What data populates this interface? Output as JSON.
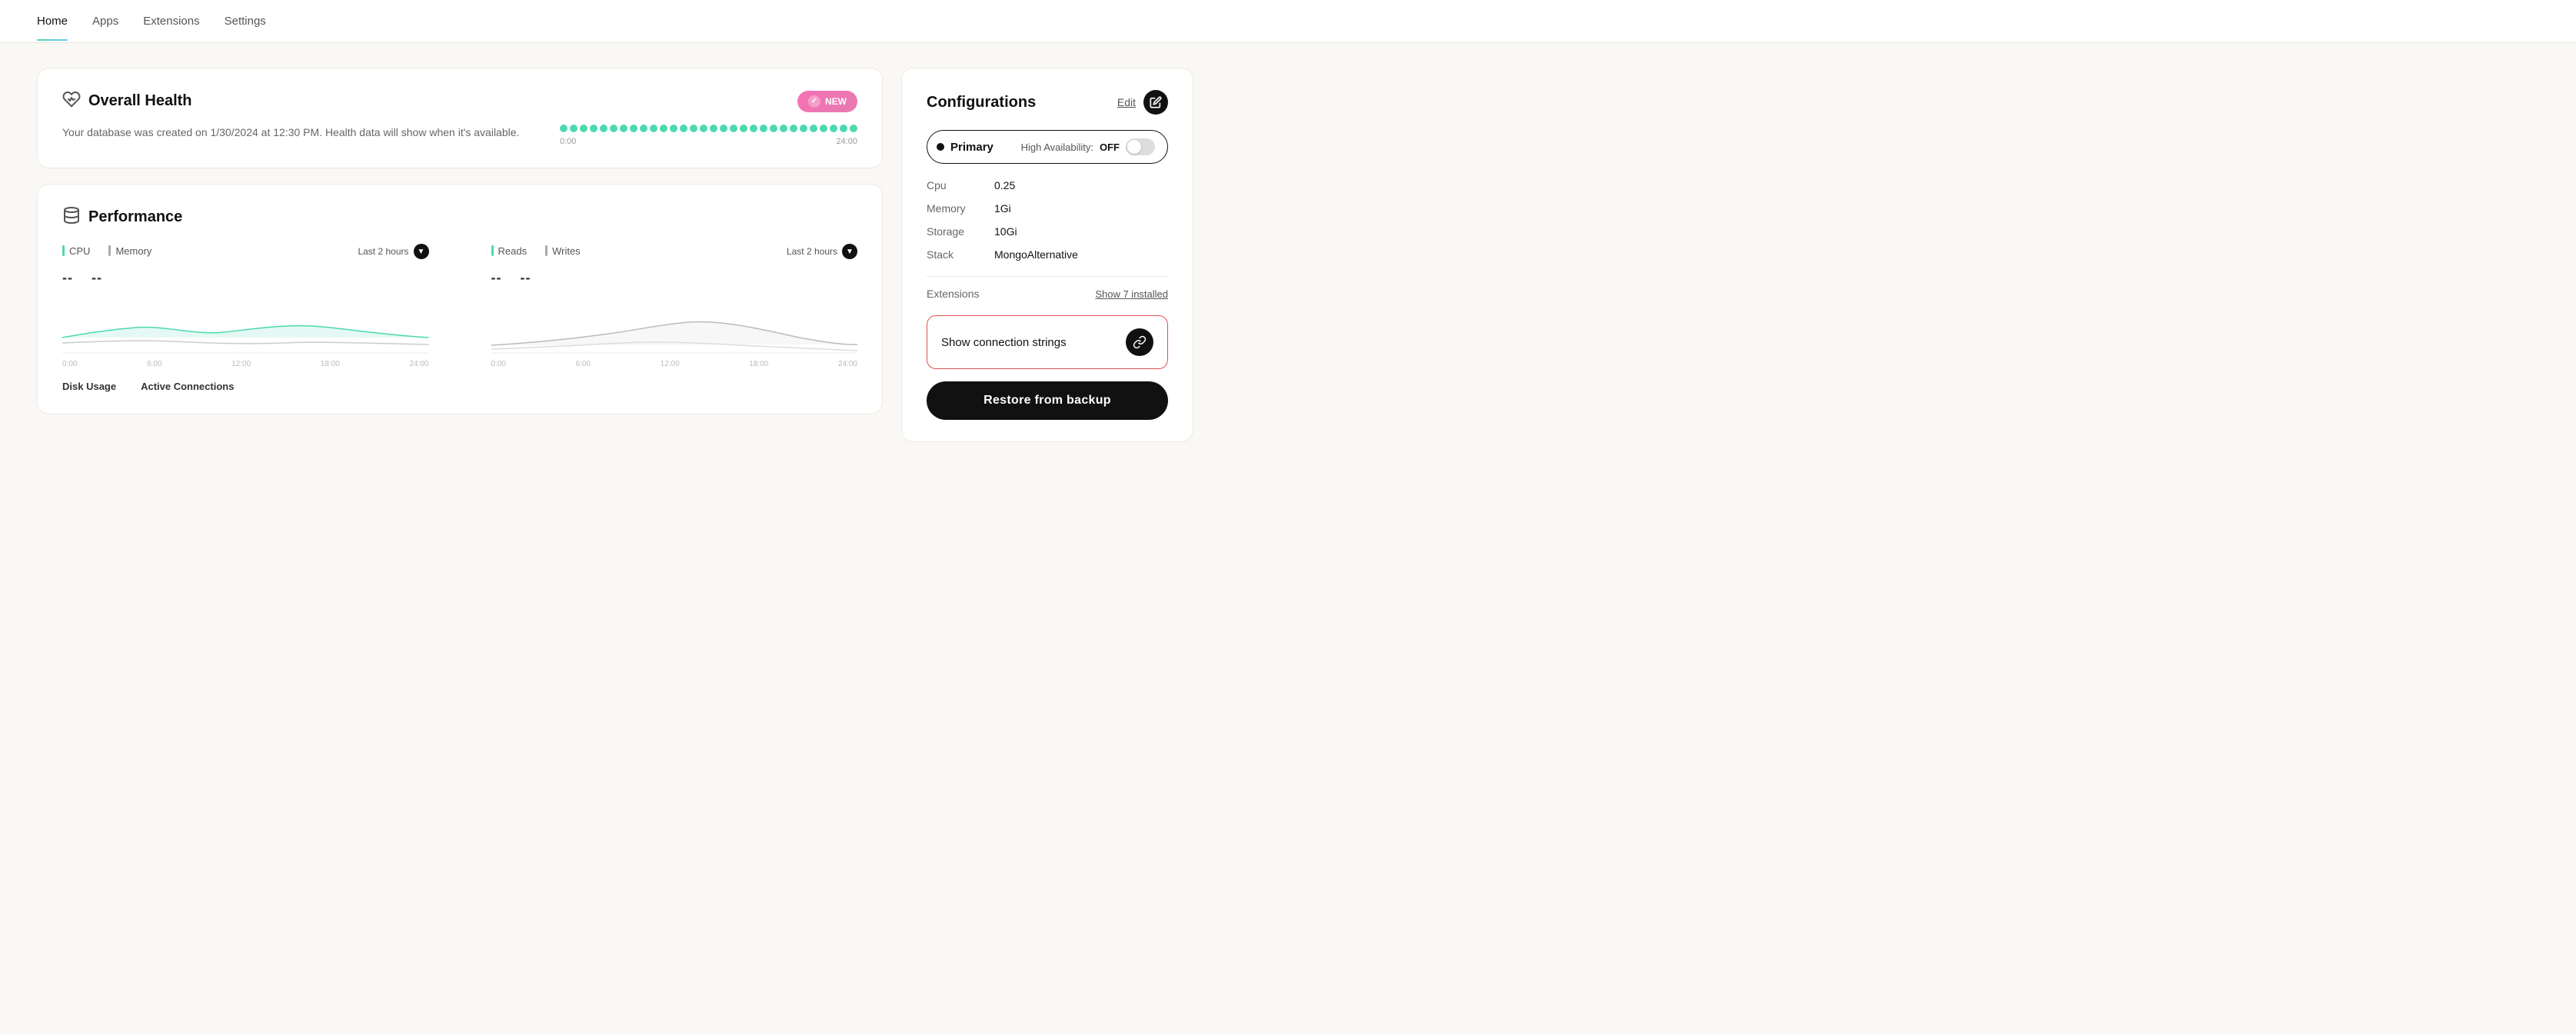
{
  "nav": {
    "items": [
      {
        "label": "Home",
        "active": true
      },
      {
        "label": "Apps",
        "active": false
      },
      {
        "label": "Extensions",
        "active": false
      },
      {
        "label": "Settings",
        "active": false
      }
    ]
  },
  "health": {
    "title": "Overall Health",
    "badge": "NEW",
    "message": "Your database was created on 1/30/2024 at 12:30 PM. Health data will show when it's available.",
    "time_start": "0:00",
    "time_end": "24:00",
    "dot_count": 30
  },
  "performance": {
    "title": "Performance",
    "left_chart": {
      "labels": [
        "CPU",
        "Memory"
      ],
      "time_label": "Last 2 hours",
      "values": [
        "--",
        "--"
      ]
    },
    "right_chart": {
      "labels": [
        "Reads",
        "Writes"
      ],
      "time_label": "Last 2 hours",
      "values": [
        "--",
        "--"
      ]
    },
    "bottom_labels": [
      "Disk Usage",
      "Active Connections"
    ]
  },
  "configurations": {
    "title": "Configurations",
    "edit_label": "Edit",
    "primary": {
      "label": "Primary",
      "ha_label": "High Availability:",
      "ha_value": "OFF"
    },
    "specs": [
      {
        "key": "Cpu",
        "value": "0.25"
      },
      {
        "key": "Memory",
        "value": "1Gi"
      },
      {
        "key": "Storage",
        "value": "10Gi"
      },
      {
        "key": "Stack",
        "value": "MongoAlternative"
      }
    ],
    "extensions": {
      "label": "Extensions",
      "show_installed": "Show 7 installed"
    },
    "connection_strings": "Show connection strings",
    "restore_button": "Restore from backup"
  }
}
